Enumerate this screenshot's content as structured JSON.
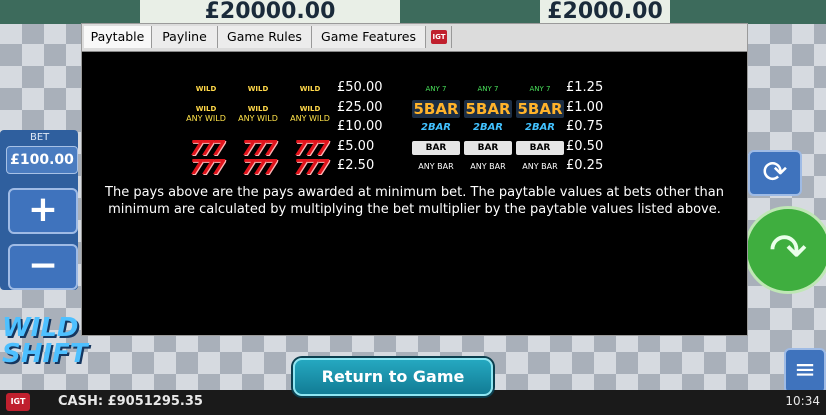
{
  "background": {
    "jackpot_left": "£20000.00",
    "jackpot_right": "£2000.00",
    "bet_label": "BET",
    "bet_value": "£100.00",
    "plus_label": "+",
    "minus_label": "−",
    "logo_text": "WILD SHIFT",
    "cash": "CASH: £9051295.35",
    "clock": "10:34"
  },
  "dialog": {
    "tabs": [
      {
        "label": "Paytable",
        "active": true
      },
      {
        "label": "Payline",
        "active": false
      },
      {
        "label": "Game Rules",
        "active": false
      },
      {
        "label": "Game Features",
        "active": false
      }
    ],
    "paytable_left": [
      {
        "symbols": [
          "WILD",
          "WILD",
          "WILD"
        ],
        "kind": "wild",
        "amount": "£50.00"
      },
      {
        "symbols": [
          "WILD",
          "WILD",
          "WILD"
        ],
        "kind": "wild",
        "amount": "£25.00"
      },
      {
        "symbols": [
          "ANY WILD",
          "ANY WILD",
          "ANY WILD"
        ],
        "kind": "anywild",
        "amount": "£10.00"
      },
      {
        "symbols": [
          "777",
          "777",
          "777"
        ],
        "kind": "seven",
        "amount": "£5.00"
      },
      {
        "symbols": [
          "777",
          "777",
          "777"
        ],
        "kind": "seven",
        "amount": "£2.50"
      }
    ],
    "paytable_right": [
      {
        "symbols": [
          "ANY 7",
          "ANY 7",
          "ANY 7"
        ],
        "kind": "any7",
        "amount": "£1.25"
      },
      {
        "symbols": [
          "5BAR",
          "5BAR",
          "5BAR"
        ],
        "kind": "bar5",
        "amount": "£1.00"
      },
      {
        "symbols": [
          "2BAR",
          "2BAR",
          "2BAR"
        ],
        "kind": "bar2",
        "amount": "£0.75"
      },
      {
        "symbols": [
          "BAR",
          "BAR",
          "BAR"
        ],
        "kind": "bar1",
        "amount": "£0.50"
      },
      {
        "symbols": [
          "ANY BAR",
          "ANY BAR",
          "ANY BAR"
        ],
        "kind": "anybar",
        "amount": "£0.25"
      }
    ],
    "note": "The pays above are the pays awarded at minimum bet. The paytable values at bets other than minimum are calculated by multiplying the bet multiplier by the paytable values listed above."
  },
  "return_button": "Return to Game"
}
